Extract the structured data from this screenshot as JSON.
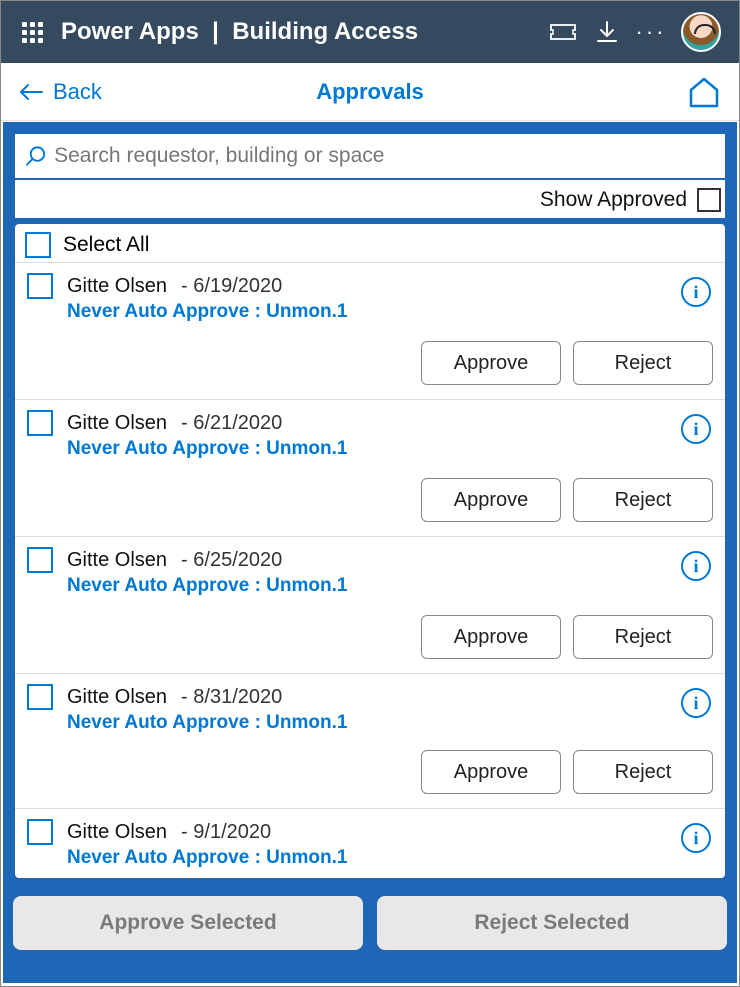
{
  "header": {
    "app_name": "Power Apps",
    "separator": "|",
    "page_name": "Building Access"
  },
  "subheader": {
    "back_label": "Back",
    "title": "Approvals"
  },
  "search": {
    "placeholder": "Search requestor, building or space"
  },
  "show_approved_label": "Show Approved",
  "select_all_label": "Select All",
  "requests": [
    {
      "name": "Gitte Olsen",
      "date": "- 6/19/2020",
      "detail": "Never Auto Approve : Unmon.1"
    },
    {
      "name": "Gitte Olsen",
      "date": "- 6/21/2020",
      "detail": "Never Auto Approve : Unmon.1"
    },
    {
      "name": "Gitte Olsen",
      "date": "- 6/25/2020",
      "detail": "Never Auto Approve : Unmon.1"
    },
    {
      "name": "Gitte Olsen",
      "date": "- 8/31/2020",
      "detail": "Never Auto Approve : Unmon.1"
    },
    {
      "name": "Gitte Olsen",
      "date": "- 9/1/2020",
      "detail": "Never Auto Approve : Unmon.1"
    }
  ],
  "buttons": {
    "approve": "Approve",
    "reject": "Reject",
    "approve_selected": "Approve Selected",
    "reject_selected": "Reject Selected"
  }
}
